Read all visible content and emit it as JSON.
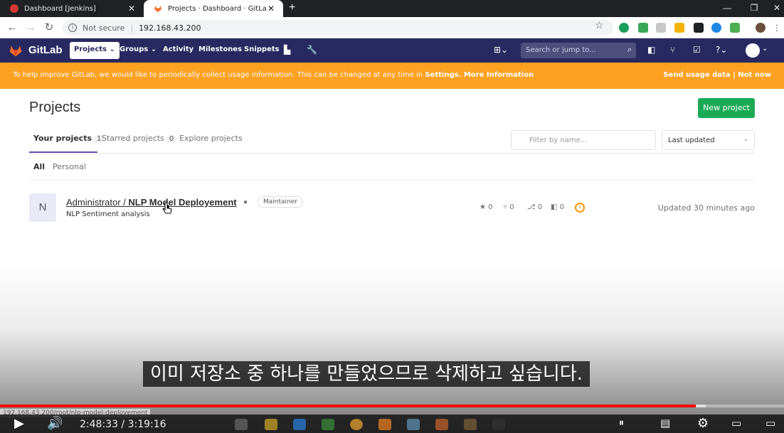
{
  "browser": {
    "tabs": [
      {
        "title": "Dashboard [Jenkins]",
        "close": "✕"
      },
      {
        "title": "Projects · Dashboard · GitLab",
        "close": "✕"
      }
    ],
    "new_tab": "+",
    "address": {
      "security_label": "Not secure",
      "host": "192.168.43.200"
    }
  },
  "gitlab_header": {
    "brand": "GitLab",
    "nav": [
      {
        "label": "Projects ⌄"
      },
      {
        "label": "Groups ⌄"
      },
      {
        "label": "Activity"
      },
      {
        "label": "Milestones"
      },
      {
        "label": "Snippets"
      }
    ],
    "search_placeholder": "Search or jump to..."
  },
  "banner": {
    "message_prefix": "To help improve GitLab, we would like to periodically collect usage information. This can be changed at any time in ",
    "settings_link": "Settings",
    "more_info_link": "More Information",
    "send_usage": "Send usage data",
    "divider": "|",
    "not_now": "Not now"
  },
  "projects_page": {
    "title": "Projects",
    "new_project_button": "New project",
    "tabs": [
      {
        "label": "Your projects",
        "count": "1"
      },
      {
        "label": "Starred projects",
        "count": "0"
      },
      {
        "label": "Explore projects"
      }
    ],
    "filter_placeholder": "Filter by name...",
    "sort_value": "Last updated",
    "subtabs": [
      {
        "label": "All"
      },
      {
        "label": "Personal"
      }
    ],
    "project": {
      "avatar_letter": "N",
      "namespace": "Administrator / ",
      "name": "NLP Model Deployement",
      "role": "Maintainer",
      "description": "NLP Sentiment analysis",
      "stars": "0",
      "forks": "0",
      "merge_requests": "0",
      "issues": "0",
      "updated": "Updated 30 minutes ago"
    }
  },
  "video_overlay": {
    "subtitle": "이미 저장소 중 하나를 만들었으므로 삭제하고 싶습니다.",
    "status_url": "192.168.43.200/root/nlp-model-deployement",
    "time_display": "2:48:33 / 3:19:16",
    "progress_fraction": 0.8874,
    "buffer_fraction": 0.9
  },
  "colors": {
    "gitlab_header": "#292961",
    "banner": "#fca121",
    "new_project": "#1aaa55",
    "progress": "#ff0000"
  }
}
